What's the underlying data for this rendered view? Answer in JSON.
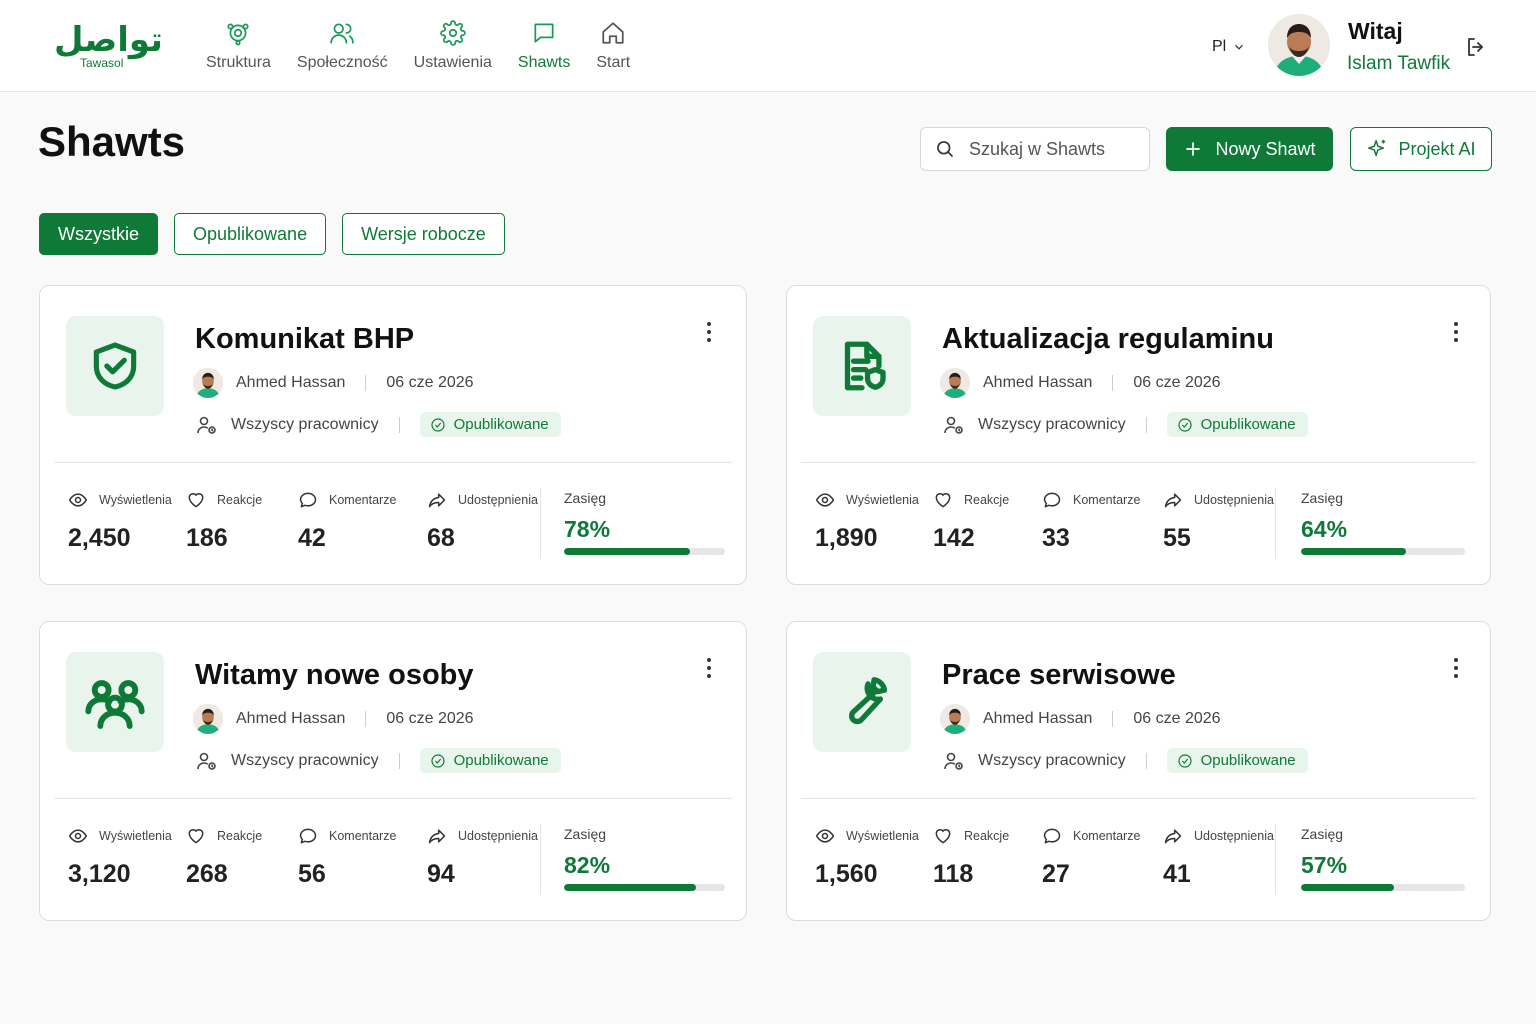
{
  "app": {
    "logo_arabic": "تواصل",
    "logo_sub": "Tawasol"
  },
  "nav": [
    {
      "label": "Struktura",
      "icon": "structure-icon",
      "active": false
    },
    {
      "label": "Społeczność",
      "icon": "people-icon",
      "active": false
    },
    {
      "label": "Ustawienia",
      "icon": "gear-icon",
      "active": false
    },
    {
      "label": "Shawts",
      "icon": "chat-icon",
      "active": true
    },
    {
      "label": "Start",
      "icon": "home-icon",
      "active": false
    }
  ],
  "user": {
    "lang": "Pl",
    "greeting": "Witaj",
    "name": "Islam Tawfik"
  },
  "page": {
    "title": "Shawts"
  },
  "search": {
    "placeholder": "Szukaj w Shawts"
  },
  "buttons": {
    "new": "Nowy Shawt",
    "ai": "Projekt AI"
  },
  "filters": [
    {
      "label": "Wszystkie",
      "active": true
    },
    {
      "label": "Opublikowane",
      "active": false
    },
    {
      "label": "Wersje robocze",
      "active": false
    }
  ],
  "stat_labels": {
    "views": "Wyświetlenia",
    "reactions": "Reakcje",
    "comments": "Komentarze",
    "shares": "Udostępnienia",
    "reach": "Zasięg"
  },
  "cards": [
    {
      "title": "Komunikat BHP",
      "icon": "shield-check-icon",
      "author": "Ahmed Hassan",
      "date": "06 cze 2026",
      "audience": "Wszyscy pracownicy",
      "status": "Opublikowane",
      "views": "2,450",
      "reactions": "186",
      "comments": "42",
      "shares": "68",
      "reach": "78%",
      "reach_value": 78
    },
    {
      "title": "Aktualizacja regulaminu",
      "icon": "document-shield-icon",
      "author": "Ahmed Hassan",
      "date": "06 cze 2026",
      "audience": "Wszyscy pracownicy",
      "status": "Opublikowane",
      "views": "1,890",
      "reactions": "142",
      "comments": "33",
      "shares": "55",
      "reach": "64%",
      "reach_value": 64
    },
    {
      "title": "Witamy nowe osoby",
      "icon": "group-icon",
      "author": "Ahmed Hassan",
      "date": "06 cze 2026",
      "audience": "Wszyscy pracownicy",
      "status": "Opublikowane",
      "views": "3,120",
      "reactions": "268",
      "comments": "56",
      "shares": "94",
      "reach": "82%",
      "reach_value": 82
    },
    {
      "title": "Prace serwisowe",
      "icon": "wrench-icon",
      "author": "Ahmed Hassan",
      "date": "06 cze 2026",
      "audience": "Wszyscy pracownicy",
      "status": "Opublikowane",
      "views": "1,560",
      "reactions": "118",
      "comments": "27",
      "shares": "41",
      "reach": "57%",
      "reach_value": 57
    }
  ],
  "colors": {
    "brand": "#0f7a38",
    "icon_bg": "#e9f5ec",
    "badge_bg": "#e7f5ea"
  }
}
